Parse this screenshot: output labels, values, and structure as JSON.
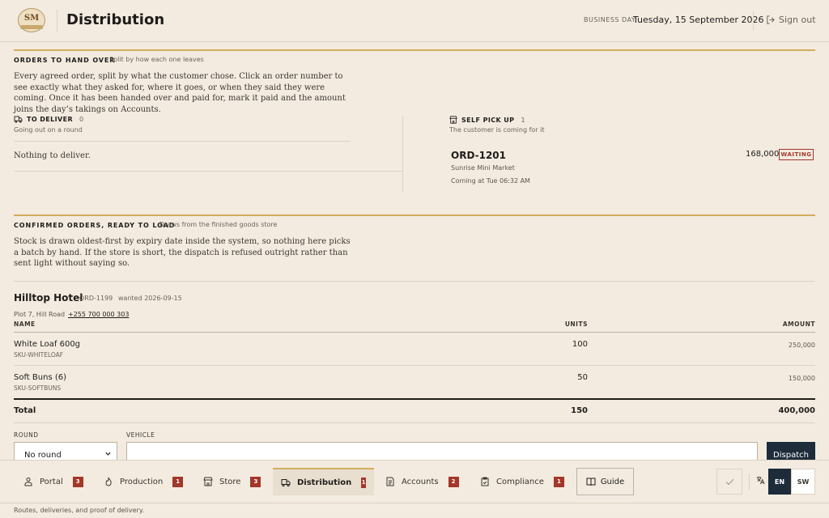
{
  "header": {
    "logo_text": "SM",
    "title": "Distribution",
    "business_day_label": "BUSINESS DAY",
    "business_day": "Tuesday, 15 September 2026",
    "sign_out": "Sign out"
  },
  "handover": {
    "heading": "ORDERS TO HAND OVER",
    "subheading": "Split by how each one leaves",
    "description": "Every agreed order, split by what the customer chose. Click an order number to see exactly what they asked for, where it goes, or when they said they were coming. Once it has been handed over and paid for, mark it paid and the amount joins the day’s takings on Accounts.",
    "deliver": {
      "label": "TO DELIVER",
      "count": "0",
      "sub": "Going out on a round",
      "empty": "Nothing to deliver."
    },
    "pickup": {
      "label": "SELF PICK UP",
      "count": "1",
      "sub": "The customer is coming for it",
      "orders": [
        {
          "number": "ORD-1201",
          "customer": "Sunrise Mini Market",
          "amount": "168,000",
          "status": "WAITING",
          "time": "Coming at Tue 06:32 AM"
        }
      ]
    }
  },
  "confirmed": {
    "heading": "CONFIRMED ORDERS, READY TO LOAD",
    "subheading": "Draws from the finished goods store",
    "description": "Stock is drawn oldest-first by expiry date inside the system, so nothing here picks a batch by hand. If the store is short, the dispatch is refused outright rather than sent light without saying so.",
    "order": {
      "customer": "Hilltop Hotel",
      "number": "ORD-1199",
      "wanted": "wanted 2026-09-15",
      "address": "Plot 7, Hill Road",
      "phone": "+255 700 000 303",
      "columns": {
        "name": "NAME",
        "units": "UNITS",
        "amount": "AMOUNT"
      },
      "items": [
        {
          "name": "White Loaf 600g",
          "sku": "SKU-WHITELOAF",
          "units": "100",
          "amount": "250,000"
        },
        {
          "name": "Soft Buns (6)",
          "sku": "SKU-SOFTBUNS",
          "units": "50",
          "amount": "150,000"
        }
      ],
      "total_label": "Total",
      "total_units": "150",
      "total_amount": "400,000",
      "round_label": "ROUND",
      "round_value": "No round",
      "vehicle_label": "VEHICLE",
      "vehicle_value": "",
      "dispatch_label": "Dispatch"
    }
  },
  "nav": {
    "items": [
      {
        "label": "Portal",
        "badge": "3",
        "icon": "portal-icon"
      },
      {
        "label": "Production",
        "badge": "1",
        "icon": "flame-icon"
      },
      {
        "label": "Store",
        "badge": "3",
        "icon": "store-icon"
      },
      {
        "label": "Distribution",
        "badge": "1",
        "icon": "truck-icon"
      },
      {
        "label": "Accounts",
        "badge": "2",
        "icon": "document-icon"
      },
      {
        "label": "Compliance",
        "badge": "1",
        "icon": "clipboard-icon"
      }
    ],
    "guide": "Guide",
    "lang_en": "EN",
    "lang_sw": "SW",
    "footnote": "Routes, deliveries, and proof of delivery."
  },
  "colors": {
    "accent_gold": "#d1ad5b",
    "badge_red": "#a3372a",
    "navy": "#1d2b3a",
    "background": "#f3ebe0"
  }
}
